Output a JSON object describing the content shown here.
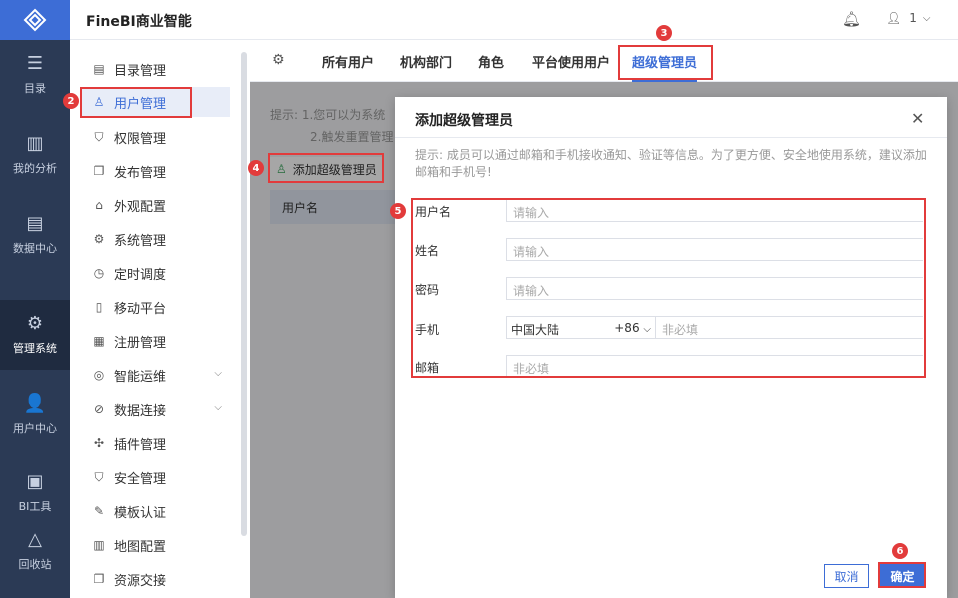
{
  "app": {
    "brand": "FineBI商业智能",
    "user_badge": "1"
  },
  "rail": {
    "items": [
      {
        "label": "目录",
        "icon": "catalog-icon"
      },
      {
        "label": "我的分析",
        "icon": "analysis-icon"
      },
      {
        "label": "数据中心",
        "icon": "data-center-icon"
      },
      {
        "label": "管理系统",
        "icon": "settings-gear-icon"
      },
      {
        "label": "用户中心",
        "icon": "user-center-icon"
      },
      {
        "label": "BI工具",
        "icon": "toolbox-icon"
      },
      {
        "label": "回收站",
        "icon": "recycle-bin-icon"
      }
    ]
  },
  "menu": {
    "items": [
      {
        "label": "目录管理"
      },
      {
        "label": "用户管理"
      },
      {
        "label": "权限管理"
      },
      {
        "label": "发布管理"
      },
      {
        "label": "外观配置"
      },
      {
        "label": "系统管理"
      },
      {
        "label": "定时调度"
      },
      {
        "label": "移动平台"
      },
      {
        "label": "注册管理"
      },
      {
        "label": "智能运维"
      },
      {
        "label": "数据连接"
      },
      {
        "label": "插件管理"
      },
      {
        "label": "安全管理"
      },
      {
        "label": "模板认证"
      },
      {
        "label": "地图配置"
      },
      {
        "label": "资源交接"
      }
    ]
  },
  "tabs": [
    {
      "label": "所有用户"
    },
    {
      "label": "机构部门"
    },
    {
      "label": "角色"
    },
    {
      "label": "平台使用用户"
    },
    {
      "label": "超级管理员"
    }
  ],
  "page": {
    "hint_line1": "提示:  1.您可以为系统",
    "hint_line2": "2.触发重置管理",
    "add_button": "添加超级管理员",
    "col_username": "用户名"
  },
  "dialog": {
    "title": "添加超级管理员",
    "hint": "提示:   成员可以通过邮箱和手机接收通知、验证等信息。为了更方便、安全地使用系统，建议添加邮箱和手机号!",
    "fields": {
      "username": {
        "label": "用户名",
        "placeholder": "请输入"
      },
      "name": {
        "label": "姓名",
        "placeholder": "请输入"
      },
      "password": {
        "label": "密码",
        "placeholder": "请输入"
      },
      "phone": {
        "label": "手机",
        "region": "中国大陆",
        "code": "+86",
        "placeholder": "非必填"
      },
      "email": {
        "label": "邮箱",
        "placeholder": "非必填"
      }
    },
    "cancel": "取消",
    "confirm": "确定"
  },
  "annotations": [
    "2",
    "3",
    "4",
    "5",
    "6"
  ],
  "colors": {
    "accent": "#3d6dd6",
    "annotation": "#e23b3b",
    "rail": "#2b3a55"
  }
}
